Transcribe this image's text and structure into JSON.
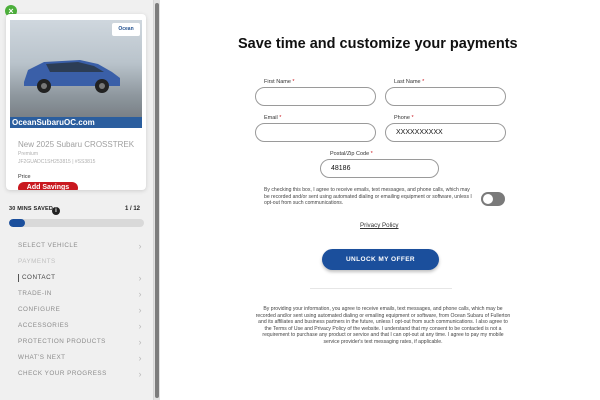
{
  "sidebar": {
    "close_icon": "close-icon",
    "dealer_logo": "Ocean",
    "dealer_url": "OceanSubaruOC.com",
    "vehicle_title": "New 2025 Subaru CROSSTREK",
    "vehicle_trim": "Premium",
    "vehicle_vin": "JF2GUADC1SH253815 | #SS3815",
    "price_label": "Price",
    "add_savings_label": "Add Savings",
    "mins_saved_label": "30 MINS SAVED",
    "info_icon": "i",
    "steps_count": "1 / 12",
    "progress_fraction": 0.12,
    "steps": [
      {
        "label": "SELECT VEHICLE",
        "state": "normal",
        "chevron": true
      },
      {
        "label": "PAYMENTS",
        "state": "dim",
        "chevron": false
      },
      {
        "label": "CONTACT",
        "state": "current",
        "chevron": true
      },
      {
        "label": "TRADE-IN",
        "state": "normal",
        "chevron": true
      },
      {
        "label": "CONFIGURE",
        "state": "normal",
        "chevron": true
      },
      {
        "label": "ACCESSORIES",
        "state": "normal",
        "chevron": true
      },
      {
        "label": "PROTECTION PRODUCTS",
        "state": "normal",
        "chevron": true
      },
      {
        "label": "WHAT'S NEXT",
        "state": "normal",
        "chevron": true
      },
      {
        "label": "CHECK YOUR PROGRESS",
        "state": "normal",
        "chevron": true
      }
    ],
    "chevron_glyph": "›"
  },
  "main": {
    "title": "Save time and customize your payments",
    "form": {
      "first_name_label": "First Name",
      "last_name_label": "Last Name",
      "email_label": "Email",
      "phone_label": "Phone",
      "postal_label": "Postal/Zip Code",
      "required_marker": "*",
      "first_name_value": "",
      "last_name_value": "",
      "email_value": "",
      "phone_value": "XXXXXXXXXX",
      "postal_value": "48186"
    },
    "consent_text": "By checking this box, I agree to receive emails, text messages, and phone calls, which may be recorded and/or sent using automated dialing or emailing equipment or software, unless I opt-out from such communications.",
    "privacy_link": "Privacy Policy",
    "unlock_button": "UNLOCK MY OFFER",
    "legal_text": "By providing your information, you agree to receive emails, text messages, and phone calls, which may be recorded and/or sent using automated dialing or emailing equipment or software, from Ocean Subaru of Fullerton and its affiliates and business partners in the future, unless I opt-out from such communications. I also agree to the Terms of Use and Privacy Policy of the website. I understand that my consent to be contacted is not a requirement to purchase any product or service and that I can opt-out at any time. I agree to pay my mobile service provider's text messaging rates, if applicable."
  },
  "colors": {
    "brand_blue": "#1b4f9c",
    "accent_red": "#c9181f",
    "close_green": "#4caf3b"
  }
}
